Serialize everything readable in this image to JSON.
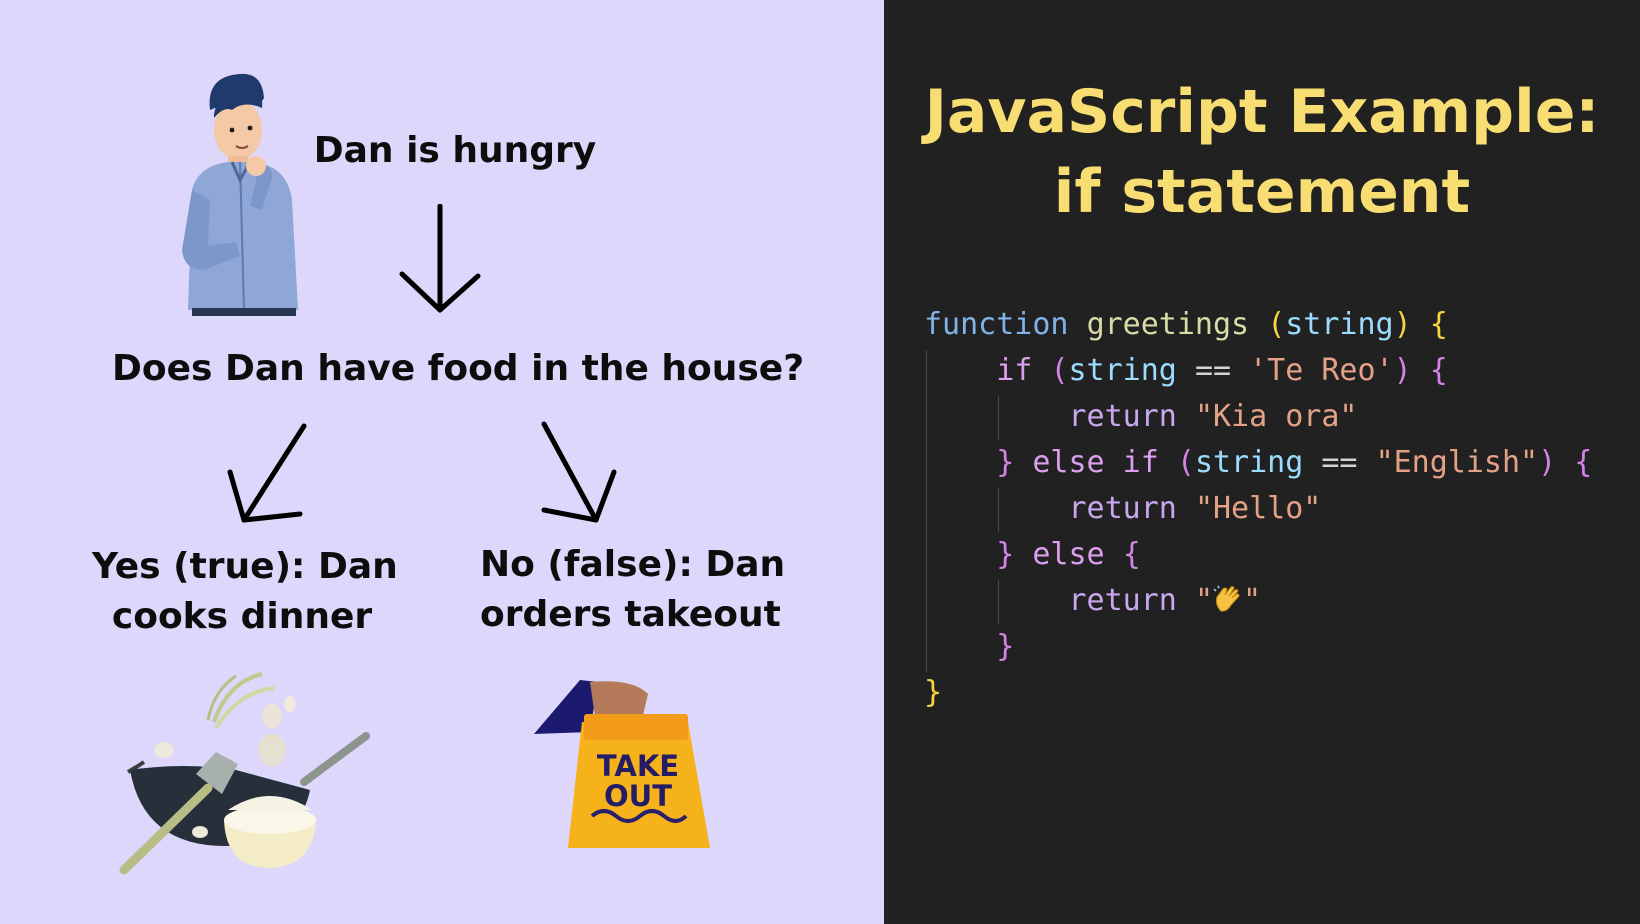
{
  "flowchart": {
    "start": "Dan is hungry",
    "question": "Does Dan have food in the house?",
    "yes": {
      "line1": "Yes (true): Dan",
      "line2": "cooks dinner"
    },
    "no": {
      "line1": "No (false): Dan",
      "line2": "orders takeout"
    },
    "takeout_bag": {
      "line1": "TAKE",
      "line2": "OUT"
    }
  },
  "code_panel": {
    "title_line1": "JavaScript Example:",
    "title_line2": "if statement",
    "code": {
      "l1_kw": "function",
      "l1_fn": "greetings",
      "l1_open": "(",
      "l1_param": "string",
      "l1_close": ")",
      "l1_brace": "{",
      "l2_kw": "if",
      "l2_open": "(",
      "l2_var": "string",
      "l2_op": "==",
      "l2_str": "'Te Reo'",
      "l2_close": ")",
      "l2_brace": "{",
      "l3_kw": "return",
      "l3_str": "\"Kia ora\"",
      "l4_brace": "}",
      "l4_kw": "else if",
      "l4_open": "(",
      "l4_var": "string",
      "l4_op": "==",
      "l4_str": "\"English\"",
      "l4_close": ")",
      "l4_brace2": "{",
      "l5_kw": "return",
      "l5_str": "\"Hello\"",
      "l6_brace": "}",
      "l6_kw": "else",
      "l6_brace2": "{",
      "l7_kw": "return",
      "l7_q1": "\"",
      "l7_q2": "\"",
      "l8_brace": "}",
      "l9_brace": "}"
    }
  },
  "colors": {
    "left_bg": "#dcd7fb",
    "right_bg": "#212121",
    "title": "#f7dd72"
  }
}
